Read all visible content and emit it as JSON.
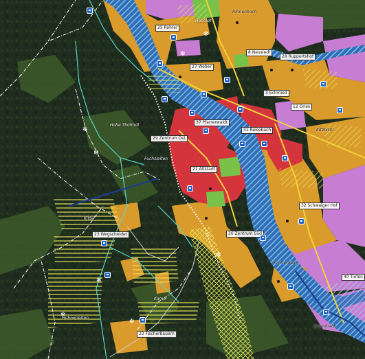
{
  "map": {
    "labels": {
      "l25": "25 Rohrer",
      "l8": "8 Neusiedl",
      "l27": "27 Weber",
      "l28": "28 Ruppertshof",
      "l3": "3 Schmied",
      "l12": "12 Gries",
      "l37": "37 Pfarrerwaldt",
      "l29": "29 Zentrum Ost",
      "l41": "41 Reisebach",
      "l21": "21 Altstadt",
      "l32": "32 Schwaiger Hof",
      "l23": "23 Wegscheider",
      "l26": "26 Zentrum Süd",
      "l22": "22 Fischerbauern",
      "l40": "40 Tiefen"
    },
    "places": {
      "thulmdt": "Hohe Thülmdt",
      "fuchsleiten": "Fuchsleiten",
      "kittel": "Kittel",
      "kamel": "Kamel",
      "huehnerleiten": "Hühnerleiten",
      "rinnenbach": "Rinnenbach",
      "hobaldt": "Hobaldt",
      "kitzbichl": "Kitzbichl",
      "krottenberg": "Krottenberg",
      "anzenbach": "Anzenbach"
    },
    "colors": {
      "forest": "#1f2d1e",
      "meadow": "#3d5a2a",
      "residential": "#d99b2b",
      "core": "#d4353c",
      "commercial": "#c77dd1",
      "river": "#2f6fb8",
      "green": "#78c24a",
      "trail_cyan": "#5ad6c8",
      "trail_white": "#f2f2f2",
      "hatch_yellow": "#e8e85a",
      "bus_blue": "#1f63c9"
    },
    "icons": [
      "bus-stop-icon",
      "viewpoint-star-icon",
      "gondola-icon"
    ]
  }
}
